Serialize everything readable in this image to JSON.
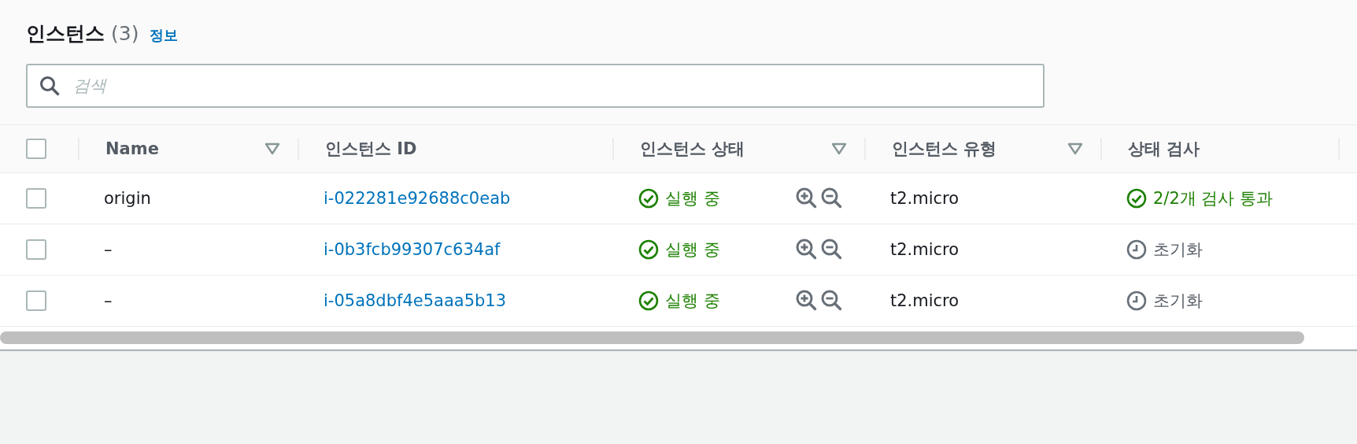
{
  "header": {
    "title": "인스턴스",
    "count": "(3)",
    "info_link": "정보"
  },
  "search": {
    "placeholder": "검색"
  },
  "table": {
    "select_all": {
      "checked": false
    },
    "columns": [
      {
        "label": "Name",
        "filter": true
      },
      {
        "label": "인스턴스 ID",
        "filter": false
      },
      {
        "label": "인스턴스 상태",
        "filter": true
      },
      {
        "label": "인스턴스 유형",
        "filter": true
      },
      {
        "label": "상태 검사",
        "filter": false
      }
    ],
    "rows": [
      {
        "checked": false,
        "name": "origin",
        "instance_id": "i-022281e92688c0eab",
        "state": {
          "kind": "running",
          "text": "실행 중"
        },
        "type": "t2.micro",
        "status_check": {
          "kind": "passed",
          "text": "2/2개 검사 통과"
        }
      },
      {
        "checked": false,
        "name": "–",
        "instance_id": "i-0b3fcb99307c634af",
        "state": {
          "kind": "running",
          "text": "실행 중"
        },
        "type": "t2.micro",
        "status_check": {
          "kind": "initializing",
          "text": "초기화"
        }
      },
      {
        "checked": false,
        "name": "–",
        "instance_id": "i-05a8dbf4e5aaa5b13",
        "state": {
          "kind": "running",
          "text": "실행 중"
        },
        "type": "t2.micro",
        "status_check": {
          "kind": "initializing",
          "text": "초기화"
        }
      }
    ]
  }
}
